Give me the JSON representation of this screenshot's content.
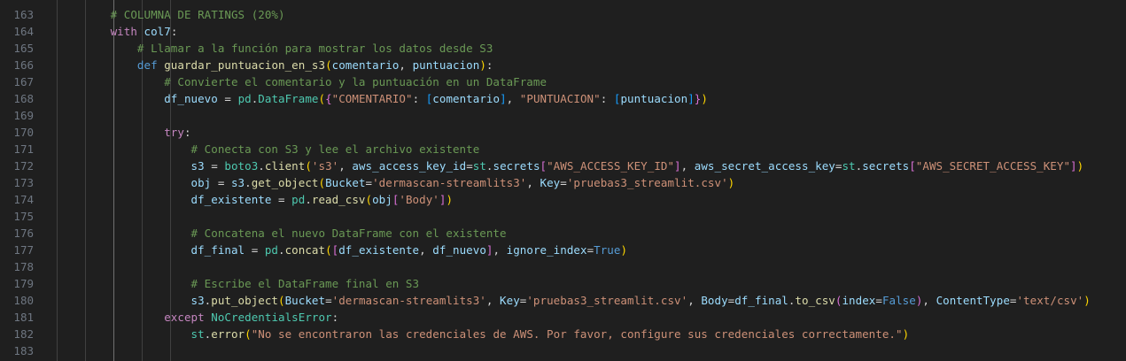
{
  "editor": {
    "lines": [
      {
        "num": "163",
        "tokens": [
          {
            "t": "        ",
            "c": "p"
          },
          {
            "t": "# COLUMNA DE RATINGS (20%)",
            "c": "c"
          }
        ]
      },
      {
        "num": "164",
        "tokens": [
          {
            "t": "        ",
            "c": "p"
          },
          {
            "t": "with",
            "c": "k"
          },
          {
            "t": " ",
            "c": "p"
          },
          {
            "t": "col7",
            "c": "v"
          },
          {
            "t": ":",
            "c": "p"
          }
        ]
      },
      {
        "num": "165",
        "tokens": [
          {
            "t": "            ",
            "c": "p"
          },
          {
            "t": "# Llamar a la función para mostrar los datos desde S3",
            "c": "c"
          }
        ]
      },
      {
        "num": "166",
        "tokens": [
          {
            "t": "            ",
            "c": "p"
          },
          {
            "t": "def",
            "c": "kb"
          },
          {
            "t": " ",
            "c": "p"
          },
          {
            "t": "guardar_puntuacion_en_s3",
            "c": "f"
          },
          {
            "t": "(",
            "c": "b1"
          },
          {
            "t": "comentario",
            "c": "v"
          },
          {
            "t": ", ",
            "c": "p"
          },
          {
            "t": "puntuacion",
            "c": "v"
          },
          {
            "t": ")",
            "c": "b1"
          },
          {
            "t": ":",
            "c": "p"
          }
        ]
      },
      {
        "num": "167",
        "tokens": [
          {
            "t": "                ",
            "c": "p"
          },
          {
            "t": "# Convierte el comentario y la puntuación en un DataFrame",
            "c": "c"
          }
        ]
      },
      {
        "num": "168",
        "tokens": [
          {
            "t": "                ",
            "c": "p"
          },
          {
            "t": "df_nuevo",
            "c": "v"
          },
          {
            "t": " = ",
            "c": "p"
          },
          {
            "t": "pd",
            "c": "cl"
          },
          {
            "t": ".",
            "c": "p"
          },
          {
            "t": "DataFrame",
            "c": "cl"
          },
          {
            "t": "(",
            "c": "b1"
          },
          {
            "t": "{",
            "c": "b2"
          },
          {
            "t": "\"COMENTARIO\"",
            "c": "s"
          },
          {
            "t": ": ",
            "c": "p"
          },
          {
            "t": "[",
            "c": "b3"
          },
          {
            "t": "comentario",
            "c": "v"
          },
          {
            "t": "]",
            "c": "b3"
          },
          {
            "t": ", ",
            "c": "p"
          },
          {
            "t": "\"PUNTUACION\"",
            "c": "s"
          },
          {
            "t": ": ",
            "c": "p"
          },
          {
            "t": "[",
            "c": "b3"
          },
          {
            "t": "puntuacion",
            "c": "v"
          },
          {
            "t": "]",
            "c": "b3"
          },
          {
            "t": "}",
            "c": "b2"
          },
          {
            "t": ")",
            "c": "b1"
          }
        ]
      },
      {
        "num": "169",
        "tokens": []
      },
      {
        "num": "170",
        "tokens": [
          {
            "t": "                ",
            "c": "p"
          },
          {
            "t": "try",
            "c": "k"
          },
          {
            "t": ":",
            "c": "p"
          }
        ]
      },
      {
        "num": "171",
        "tokens": [
          {
            "t": "                    ",
            "c": "p"
          },
          {
            "t": "# Conecta con S3 y lee el archivo existente",
            "c": "c"
          }
        ]
      },
      {
        "num": "172",
        "tokens": [
          {
            "t": "                    ",
            "c": "p"
          },
          {
            "t": "s3",
            "c": "v"
          },
          {
            "t": " = ",
            "c": "p"
          },
          {
            "t": "boto3",
            "c": "cl"
          },
          {
            "t": ".",
            "c": "p"
          },
          {
            "t": "client",
            "c": "f"
          },
          {
            "t": "(",
            "c": "b1"
          },
          {
            "t": "'s3'",
            "c": "s"
          },
          {
            "t": ", ",
            "c": "p"
          },
          {
            "t": "aws_access_key_id",
            "c": "v"
          },
          {
            "t": "=",
            "c": "p"
          },
          {
            "t": "st",
            "c": "cl"
          },
          {
            "t": ".",
            "c": "p"
          },
          {
            "t": "secrets",
            "c": "v"
          },
          {
            "t": "[",
            "c": "b2"
          },
          {
            "t": "\"AWS_ACCESS_KEY_ID\"",
            "c": "s"
          },
          {
            "t": "]",
            "c": "b2"
          },
          {
            "t": ", ",
            "c": "p"
          },
          {
            "t": "aws_secret_access_key",
            "c": "v"
          },
          {
            "t": "=",
            "c": "p"
          },
          {
            "t": "st",
            "c": "cl"
          },
          {
            "t": ".",
            "c": "p"
          },
          {
            "t": "secrets",
            "c": "v"
          },
          {
            "t": "[",
            "c": "b2"
          },
          {
            "t": "\"AWS_SECRET_ACCESS_KEY\"",
            "c": "s"
          },
          {
            "t": "]",
            "c": "b2"
          },
          {
            "t": ")",
            "c": "b1"
          }
        ]
      },
      {
        "num": "173",
        "tokens": [
          {
            "t": "                    ",
            "c": "p"
          },
          {
            "t": "obj",
            "c": "v"
          },
          {
            "t": " = ",
            "c": "p"
          },
          {
            "t": "s3",
            "c": "v"
          },
          {
            "t": ".",
            "c": "p"
          },
          {
            "t": "get_object",
            "c": "f"
          },
          {
            "t": "(",
            "c": "b1"
          },
          {
            "t": "Bucket",
            "c": "v"
          },
          {
            "t": "=",
            "c": "p"
          },
          {
            "t": "'dermascan-streamlits3'",
            "c": "s"
          },
          {
            "t": ", ",
            "c": "p"
          },
          {
            "t": "Key",
            "c": "v"
          },
          {
            "t": "=",
            "c": "p"
          },
          {
            "t": "'pruebas3_streamlit.csv'",
            "c": "s"
          },
          {
            "t": ")",
            "c": "b1"
          }
        ]
      },
      {
        "num": "174",
        "tokens": [
          {
            "t": "                    ",
            "c": "p"
          },
          {
            "t": "df_existente",
            "c": "v"
          },
          {
            "t": " = ",
            "c": "p"
          },
          {
            "t": "pd",
            "c": "cl"
          },
          {
            "t": ".",
            "c": "p"
          },
          {
            "t": "read_csv",
            "c": "f"
          },
          {
            "t": "(",
            "c": "b1"
          },
          {
            "t": "obj",
            "c": "v"
          },
          {
            "t": "[",
            "c": "b2"
          },
          {
            "t": "'Body'",
            "c": "s"
          },
          {
            "t": "]",
            "c": "b2"
          },
          {
            "t": ")",
            "c": "b1"
          }
        ]
      },
      {
        "num": "175",
        "tokens": []
      },
      {
        "num": "176",
        "tokens": [
          {
            "t": "                    ",
            "c": "p"
          },
          {
            "t": "# Concatena el nuevo DataFrame con el existente",
            "c": "c"
          }
        ]
      },
      {
        "num": "177",
        "tokens": [
          {
            "t": "                    ",
            "c": "p"
          },
          {
            "t": "df_final",
            "c": "v"
          },
          {
            "t": " = ",
            "c": "p"
          },
          {
            "t": "pd",
            "c": "cl"
          },
          {
            "t": ".",
            "c": "p"
          },
          {
            "t": "concat",
            "c": "f"
          },
          {
            "t": "(",
            "c": "b1"
          },
          {
            "t": "[",
            "c": "b2"
          },
          {
            "t": "df_existente",
            "c": "v"
          },
          {
            "t": ", ",
            "c": "p"
          },
          {
            "t": "df_nuevo",
            "c": "v"
          },
          {
            "t": "]",
            "c": "b2"
          },
          {
            "t": ", ",
            "c": "p"
          },
          {
            "t": "ignore_index",
            "c": "v"
          },
          {
            "t": "=",
            "c": "p"
          },
          {
            "t": "True",
            "c": "kb"
          },
          {
            "t": ")",
            "c": "b1"
          }
        ]
      },
      {
        "num": "178",
        "tokens": []
      },
      {
        "num": "179",
        "tokens": [
          {
            "t": "                    ",
            "c": "p"
          },
          {
            "t": "# Escribe el DataFrame final en S3",
            "c": "c"
          }
        ]
      },
      {
        "num": "180",
        "tokens": [
          {
            "t": "                    ",
            "c": "p"
          },
          {
            "t": "s3",
            "c": "v"
          },
          {
            "t": ".",
            "c": "p"
          },
          {
            "t": "put_object",
            "c": "f"
          },
          {
            "t": "(",
            "c": "b1"
          },
          {
            "t": "Bucket",
            "c": "v"
          },
          {
            "t": "=",
            "c": "p"
          },
          {
            "t": "'dermascan-streamlits3'",
            "c": "s"
          },
          {
            "t": ", ",
            "c": "p"
          },
          {
            "t": "Key",
            "c": "v"
          },
          {
            "t": "=",
            "c": "p"
          },
          {
            "t": "'pruebas3_streamlit.csv'",
            "c": "s"
          },
          {
            "t": ", ",
            "c": "p"
          },
          {
            "t": "Body",
            "c": "v"
          },
          {
            "t": "=",
            "c": "p"
          },
          {
            "t": "df_final",
            "c": "v"
          },
          {
            "t": ".",
            "c": "p"
          },
          {
            "t": "to_csv",
            "c": "f"
          },
          {
            "t": "(",
            "c": "b2"
          },
          {
            "t": "index",
            "c": "v"
          },
          {
            "t": "=",
            "c": "p"
          },
          {
            "t": "False",
            "c": "kb"
          },
          {
            "t": ")",
            "c": "b2"
          },
          {
            "t": ", ",
            "c": "p"
          },
          {
            "t": "ContentType",
            "c": "v"
          },
          {
            "t": "=",
            "c": "p"
          },
          {
            "t": "'text/csv'",
            "c": "s"
          },
          {
            "t": ")",
            "c": "b1"
          }
        ]
      },
      {
        "num": "181",
        "tokens": [
          {
            "t": "                ",
            "c": "p"
          },
          {
            "t": "except",
            "c": "k"
          },
          {
            "t": " ",
            "c": "p"
          },
          {
            "t": "NoCredentialsError",
            "c": "cl"
          },
          {
            "t": ":",
            "c": "p"
          }
        ]
      },
      {
        "num": "182",
        "tokens": [
          {
            "t": "                    ",
            "c": "p"
          },
          {
            "t": "st",
            "c": "cl"
          },
          {
            "t": ".",
            "c": "p"
          },
          {
            "t": "error",
            "c": "f"
          },
          {
            "t": "(",
            "c": "b1"
          },
          {
            "t": "\"No se encontraron las credenciales de AWS. Por favor, configure sus credenciales correctamente.\"",
            "c": "s"
          },
          {
            "t": ")",
            "c": "b1"
          }
        ]
      },
      {
        "num": "183",
        "tokens": []
      }
    ]
  }
}
